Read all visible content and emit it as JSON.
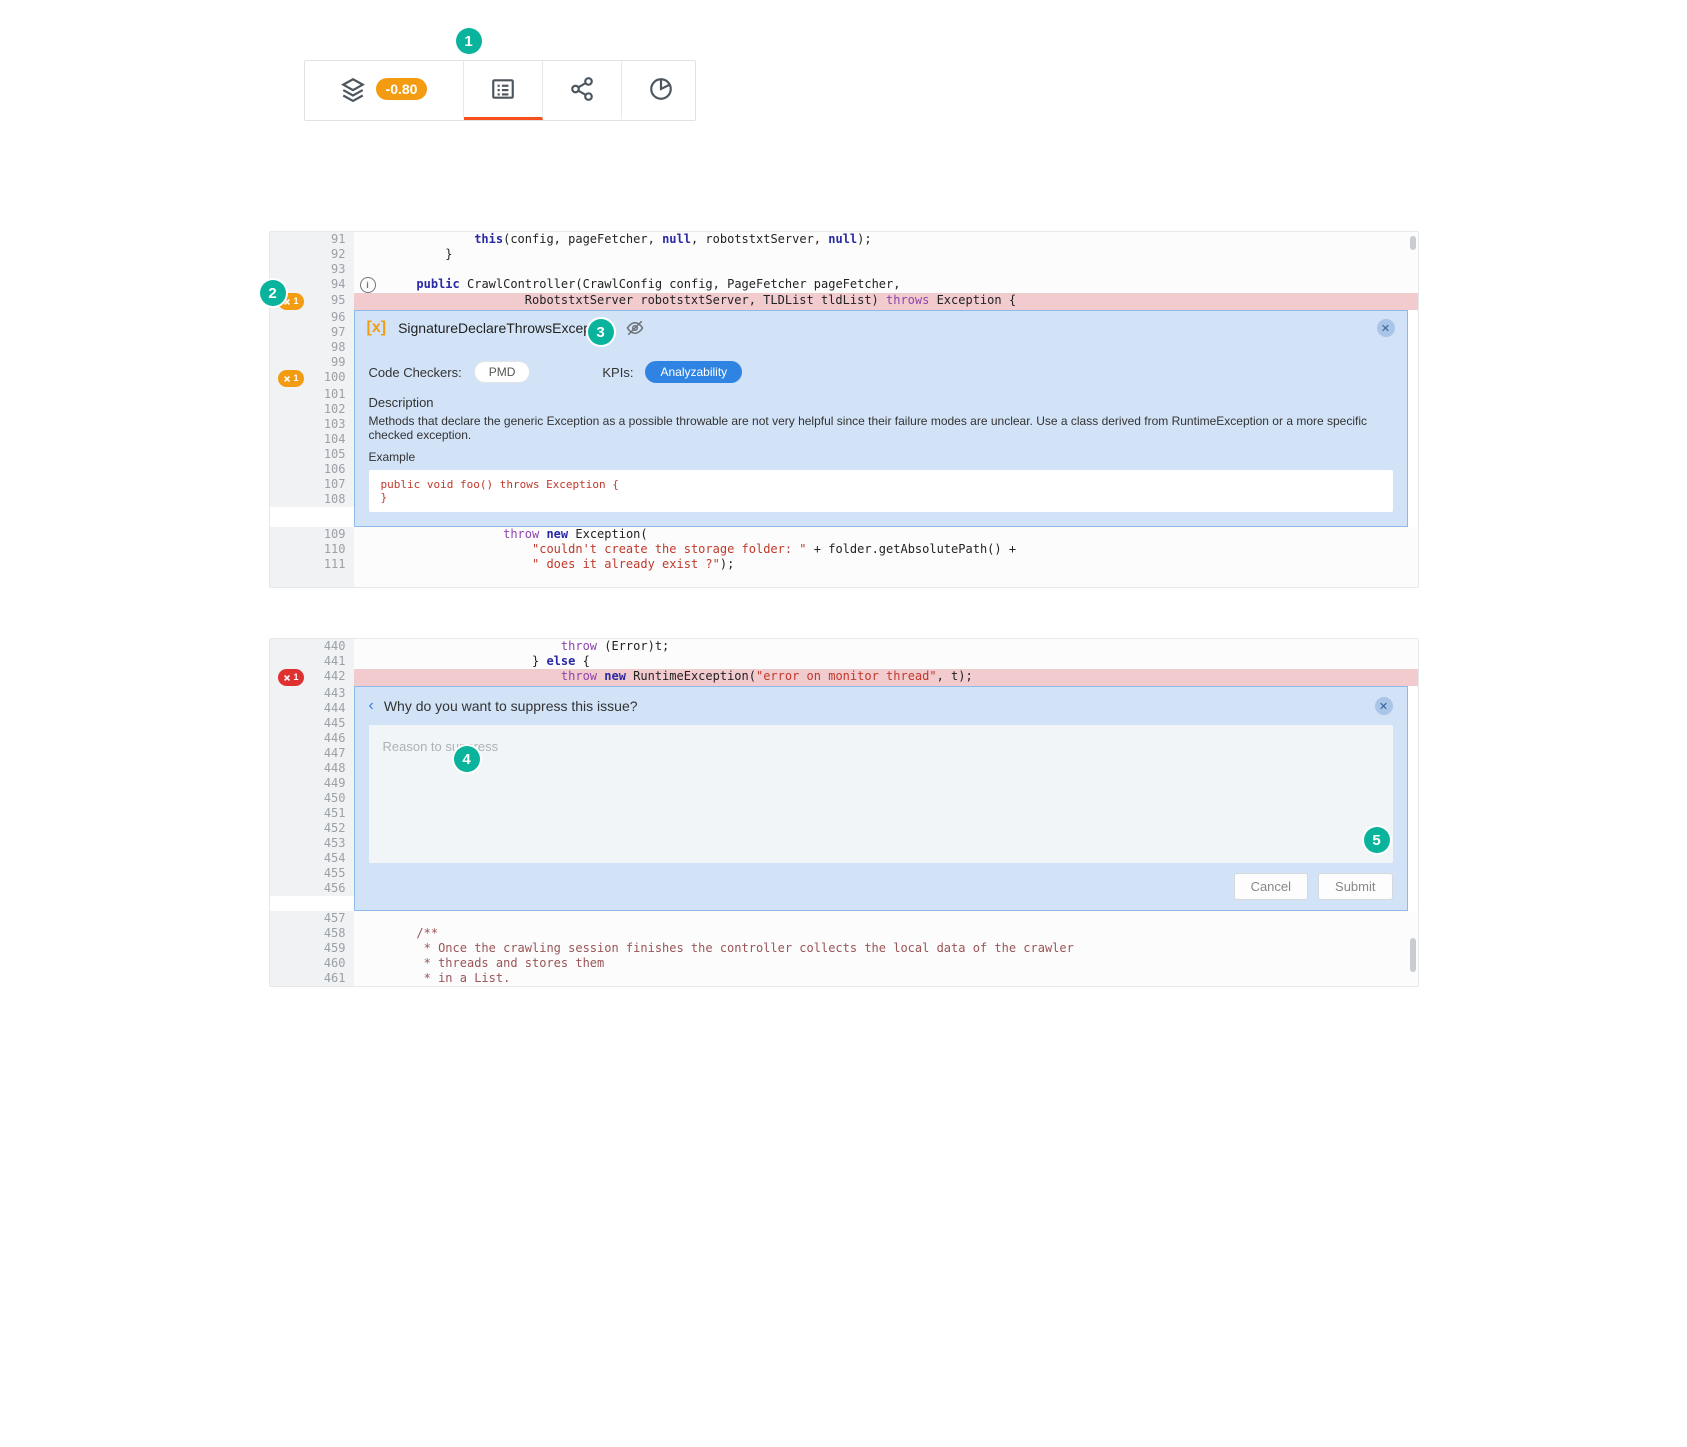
{
  "tabs": {
    "score_badge": "-0.80"
  },
  "callouts": [
    "1",
    "2",
    "3",
    "4",
    "5"
  ],
  "issue_badge_1": "1",
  "issue_badge_2": "1",
  "issue_badge_3": "1",
  "block1": {
    "l91": "            this(config, pageFetcher, null, robotstxtServer, null);",
    "l92": "        }",
    "l94a": "    public CrawlController(CrawlConfig config, PageFetcher pageFetcher,",
    "l95a": "                   RobotstxtServer robotstxtServer, TLDList tldList) throws Exception {",
    "l109": "                throw new Exception(",
    "l110": "                    \"couldn't create the storage folder: \" + folder.getAbsolutePath() +",
    "l111": "                    \" does it already exist ?\");"
  },
  "issue_panel": {
    "icon": "[x]",
    "title": "SignatureDeclareThrowsException",
    "checkers_label": "Code Checkers:",
    "checker_pill": "PMD",
    "kpis_label": "KPIs:",
    "kpi_pill": "Analyzability",
    "description_label": "Description",
    "description": "Methods that declare the generic Exception as a possible throwable are not very helpful since their failure modes are unclear. Use a class derived from RuntimeException or a more specific checked exception.",
    "example_label": "Example",
    "example_code": "public void foo() throws Exception {\n}"
  },
  "block2": {
    "l440": "                        throw (Error)t;",
    "l441": "                    } else {",
    "l442": "                        throw new RuntimeException(\"error on monitor thread\", t);",
    "l458": "    /**",
    "l459": "     * Once the crawling session finishes the controller collects the local data of the crawler",
    "l460": "     * threads and stores them",
    "l461": "     * in a List."
  },
  "suppress_panel": {
    "question": "Why do you want to suppress this issue?",
    "placeholder": "Reason to suppress",
    "cancel": "Cancel",
    "submit": "Submit"
  }
}
